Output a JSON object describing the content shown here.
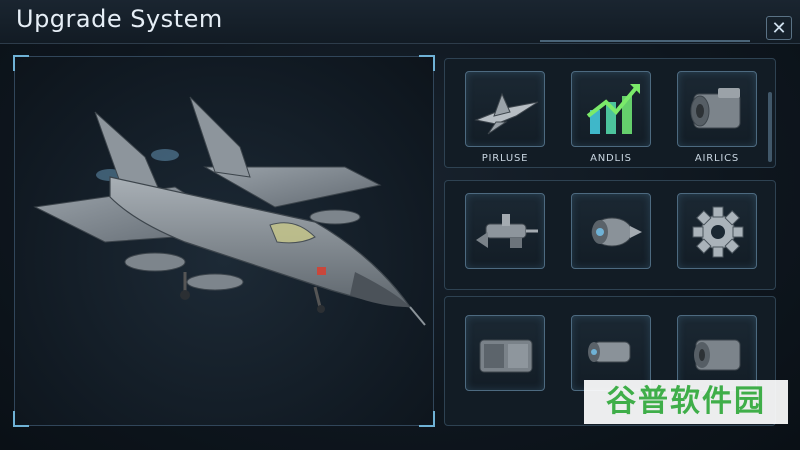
{
  "window": {
    "title": "Upgrade System",
    "close_label": "✕"
  },
  "upgrades": {
    "rows": [
      [
        {
          "label": "PIRLUSE",
          "icon": "jet-icon"
        },
        {
          "label": "ANDLIS",
          "icon": "growth-arrow-icon"
        },
        {
          "label": "AIRLICS",
          "icon": "engine-block-icon"
        }
      ],
      [
        {
          "label": "",
          "icon": "missile-pod-icon"
        },
        {
          "label": "",
          "icon": "turbine-icon"
        },
        {
          "label": "",
          "icon": "gear-icon"
        }
      ],
      [
        {
          "label": "",
          "icon": "armor-block-icon"
        },
        {
          "label": "",
          "icon": "thruster-icon"
        },
        {
          "label": "",
          "icon": "engine-core-icon"
        }
      ]
    ]
  },
  "watermark": {
    "text": "谷普软件园"
  },
  "colors": {
    "accent": "#6fb2d6",
    "frame": "#31465a",
    "watermark": "#3fae49"
  }
}
